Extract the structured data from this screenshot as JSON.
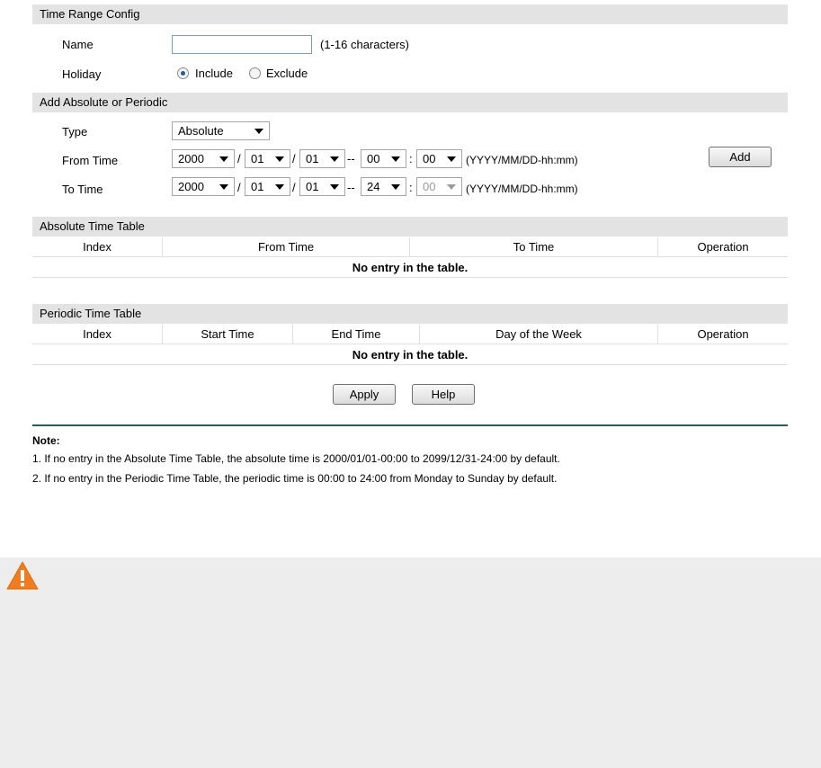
{
  "time_range_config": {
    "header": "Time Range Config",
    "name_label": "Name",
    "name_value": "",
    "name_hint": "(1-16 characters)",
    "holiday_label": "Holiday",
    "include_label": "Include",
    "exclude_label": "Exclude"
  },
  "add_section": {
    "header": "Add Absolute or Periodic",
    "type_label": "Type",
    "type_value": "Absolute",
    "from_label": "From Time",
    "to_label": "To Time",
    "from": {
      "year": "2000",
      "month": "01",
      "day": "01",
      "hour": "00",
      "minute": "00"
    },
    "to": {
      "year": "2000",
      "month": "01",
      "day": "01",
      "hour": "24",
      "minute": "00"
    },
    "slash": "/",
    "dash": "--",
    "colon": ":",
    "format_hint": "(YYYY/MM/DD-hh:mm)",
    "add_button": "Add"
  },
  "absolute_table": {
    "header": "Absolute Time Table",
    "columns": [
      "Index",
      "From Time",
      "To Time",
      "Operation"
    ],
    "empty": "No entry in the table."
  },
  "periodic_table": {
    "header": "Periodic Time Table",
    "columns": [
      "Index",
      "Start Time",
      "End Time",
      "Day of the Week",
      "Operation"
    ],
    "empty": "No entry in the table."
  },
  "buttons": {
    "apply": "Apply",
    "help": "Help"
  },
  "notes": {
    "title": "Note:",
    "items": [
      "1. If no entry in the Absolute Time Table, the absolute time is 2000/01/01-00:00 to 2099/12/31-24:00 by default.",
      "2. If no entry in the Periodic Time Table, the periodic time is 00:00 to 24:00 from Monday to Sunday by default."
    ]
  },
  "icons": {
    "warning": "warning-icon"
  },
  "colors": {
    "section_bg": "#e3e3e3",
    "note_rule": "#2d5a5a",
    "warning": "#f07c1e",
    "footer_bg": "#ededed"
  }
}
